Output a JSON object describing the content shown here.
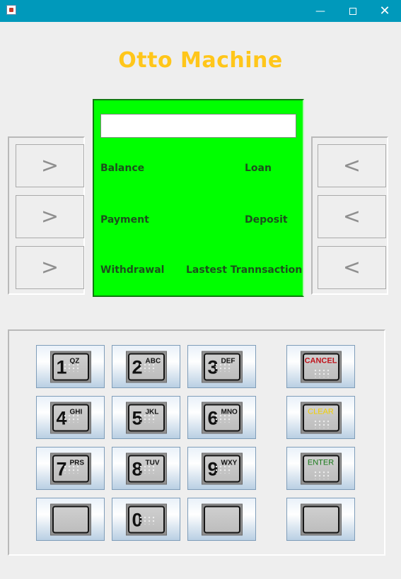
{
  "window": {
    "title": "",
    "controls": {
      "minimize": "—",
      "maximize": "",
      "close": "✕"
    }
  },
  "app": {
    "title": "Otto Machine"
  },
  "side_buttons": {
    "left": [
      ">",
      ">",
      ">"
    ],
    "right": [
      "<",
      "<",
      "<"
    ]
  },
  "screen": {
    "input_value": "",
    "bg_color": "#00ff00",
    "menu": [
      "Balance",
      "Loan",
      "Payment",
      "Deposit",
      "Withdrawal",
      "Lastest Trannsaction"
    ]
  },
  "keypad": {
    "keys": [
      {
        "digit": "1",
        "letters": "QZ"
      },
      {
        "digit": "2",
        "letters": "ABC"
      },
      {
        "digit": "3",
        "letters": "DEF"
      },
      {
        "digit": "4",
        "letters": "GHI"
      },
      {
        "digit": "5",
        "letters": "JKL"
      },
      {
        "digit": "6",
        "letters": "MNO"
      },
      {
        "digit": "7",
        "letters": "PRS"
      },
      {
        "digit": "8",
        "letters": "TUV"
      },
      {
        "digit": "9",
        "letters": "WXY"
      },
      {
        "digit": "0",
        "letters": ""
      }
    ],
    "functions": {
      "cancel": "CANCEL",
      "clear": "CLEAR",
      "enter": "ENTER"
    }
  }
}
